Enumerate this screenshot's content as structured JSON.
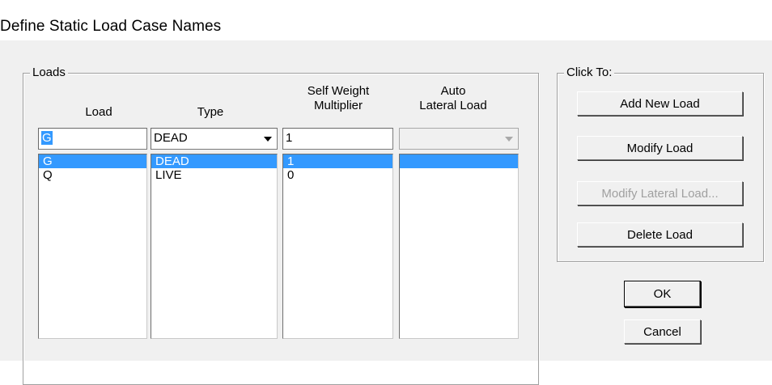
{
  "window": {
    "title": "Define Static Load Case Names"
  },
  "loads_group": {
    "label": "Loads",
    "headers": {
      "load": "Load",
      "type": "Type",
      "self_weight": "Self Weight\nMultiplier",
      "auto_lateral": "Auto\nLateral Load"
    },
    "editor": {
      "load_value": "G",
      "type_value": "DEAD",
      "multiplier_value": "1",
      "auto_lateral_value": ""
    },
    "lists": {
      "loads": [
        "G",
        "Q"
      ],
      "types": [
        "DEAD",
        "LIVE"
      ],
      "multipliers": [
        "1",
        "0"
      ],
      "auto_lateral": [
        ""
      ]
    },
    "selected_index": 0
  },
  "click_to_group": {
    "label": "Click To:",
    "add_new": "Add New Load",
    "modify": "Modify Load",
    "modify_lateral": "Modify Lateral Load...",
    "delete": "Delete Load"
  },
  "dialog_buttons": {
    "ok": "OK",
    "cancel": "Cancel"
  },
  "colors": {
    "selection": "#3399ff",
    "dialog_bg": "#f0f0f0"
  }
}
